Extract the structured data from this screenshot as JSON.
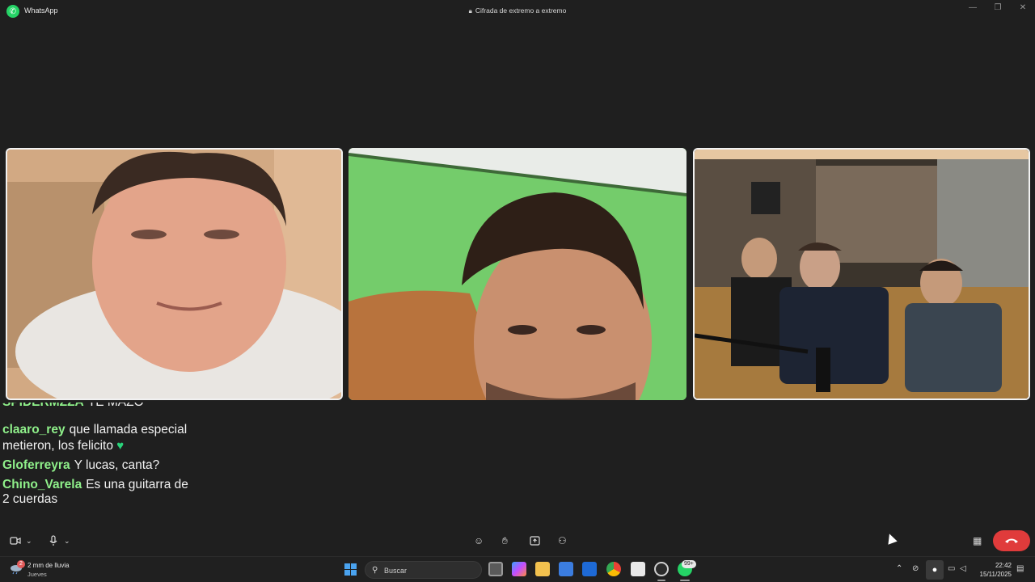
{
  "window": {
    "app_name": "WhatsApp",
    "encryption_label": "Cifrada de extremo a extremo"
  },
  "call": {
    "participants": [
      {
        "tile": 1,
        "highlighted": true
      },
      {
        "tile": 2,
        "highlighted": false
      },
      {
        "tile": 3,
        "highlighted": true
      }
    ]
  },
  "chat": {
    "messages": [
      {
        "user": "SPIDERMZZA",
        "text": "TE MAZO",
        "partial": true
      },
      {
        "user": "claaro_rey",
        "text": "que llamada especial",
        "text2": "metieron, los felicito",
        "emoji": "green-heart"
      },
      {
        "user": "Gloferreyra",
        "text": "Y lucas, canta?"
      },
      {
        "user": "Chino_Varela",
        "text": "Es una guitarra de",
        "text2": "2 cuerdas"
      }
    ]
  },
  "callbar": {
    "left_controls": [
      "video-icon",
      "chevron-down-icon",
      "mic-icon",
      "chevron-down-icon"
    ],
    "center_controls": [
      "emoji-icon",
      "raise-hand-icon",
      "share-screen-icon",
      "add-participant-icon"
    ],
    "end_call_color": "#e03b3b"
  },
  "taskbar": {
    "weather_temp": "2 mm de lluvia",
    "weather_day": "Jueves",
    "weather_badge": "2",
    "search_placeholder": "Buscar",
    "whatsapp_badge": "99+",
    "time": "22:42",
    "date": "15/11/2025"
  },
  "colors": {
    "username": "#8ff08a",
    "whatsapp_green": "#25d366",
    "end_call": "#e03b3b"
  }
}
